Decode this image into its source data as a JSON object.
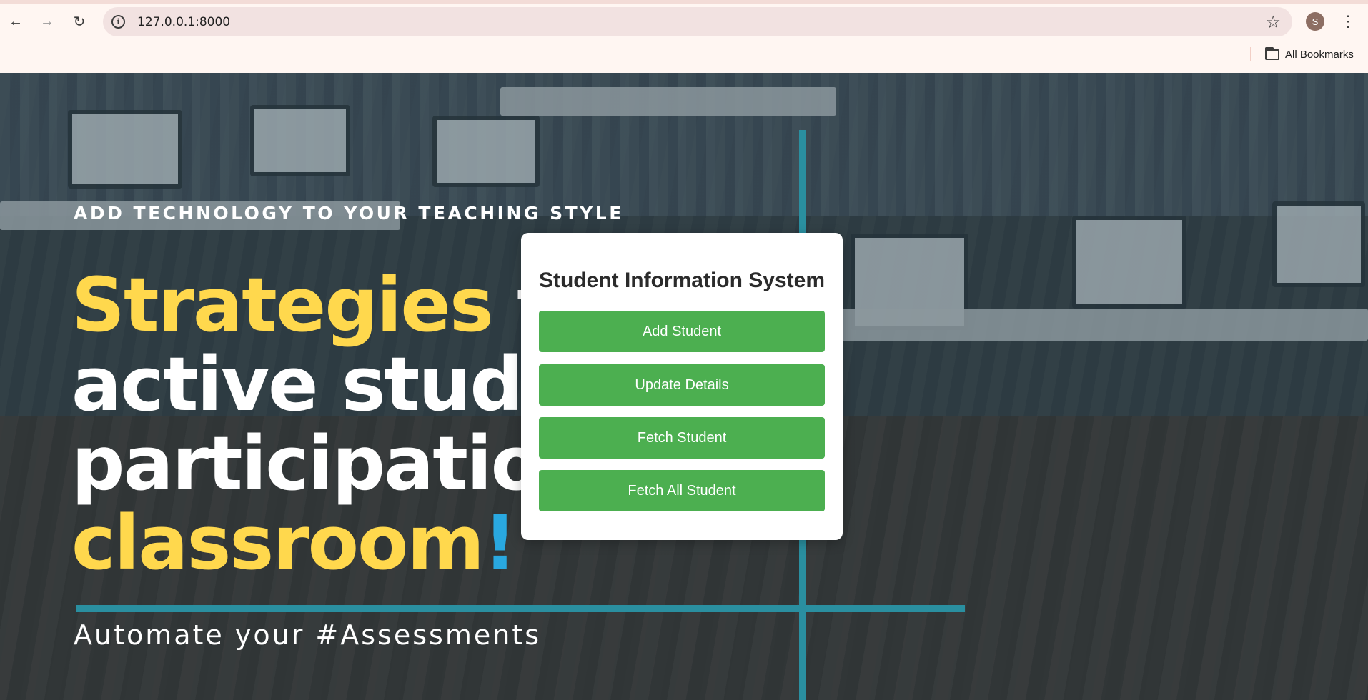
{
  "browser": {
    "url": "127.0.0.1:8000",
    "profile_initial": "S",
    "bookmarks_label": "All Bookmarks",
    "icons": {
      "back": "arrow-left-icon",
      "forward": "arrow-right-icon",
      "reload": "reload-icon",
      "site_info": "info-icon",
      "bookmark_star": "star-icon",
      "menu": "kebab-menu-icon",
      "bookmarks_folder": "folder-icon"
    }
  },
  "hero": {
    "tagline": "ADD TECHNOLOGY TO YOUR TEACHING STYLE",
    "headline": {
      "line1_highlight": "Strategies",
      "line1_rest": " to",
      "line2": "active studen",
      "line3": "participation",
      "line4_highlight": "classroom",
      "line4_punct": "!"
    },
    "subtitle": "Automate your #Assessments",
    "colors": {
      "highlight": "#ffd84d",
      "accent_blue": "#29a8e0",
      "accent_teal": "#2a8fa0"
    }
  },
  "card": {
    "title": "Student Information System",
    "buttons": [
      {
        "label": "Add Student"
      },
      {
        "label": "Update Details"
      },
      {
        "label": "Fetch Student"
      },
      {
        "label": "Fetch All Student"
      }
    ],
    "button_color": "#4caf50"
  }
}
